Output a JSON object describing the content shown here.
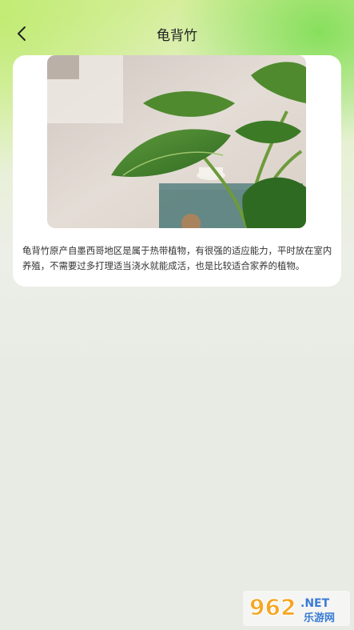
{
  "header": {
    "title": "龟背竹",
    "back_icon": "chevron-left-icon"
  },
  "plant": {
    "image_alt": "龟背竹",
    "description": "龟背竹原产自墨西哥地区是属于热带植物，有很强的适应能力，平时放在室内养殖，不需要过多打理适当浇水就能成活，也是比较适合家养的植物。"
  },
  "watermark": {
    "number": "962",
    "suffix": ".NET",
    "site_name": "乐游网"
  },
  "colors": {
    "accent_green": "#7fd957",
    "text_dark": "#222222"
  }
}
